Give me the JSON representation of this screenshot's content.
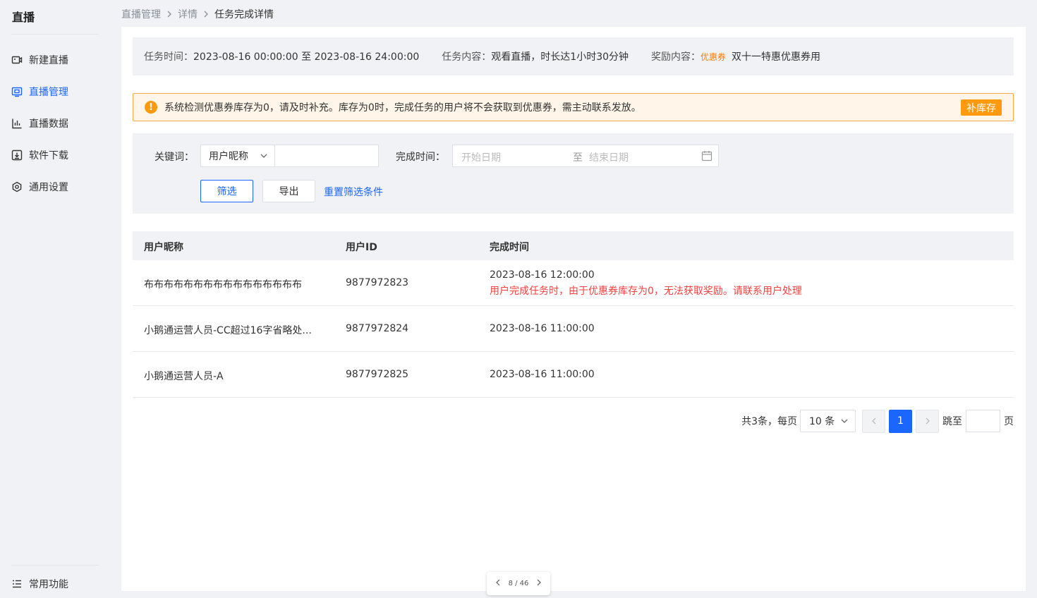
{
  "app": {
    "title": "直播"
  },
  "sidebar": {
    "items": [
      {
        "label": "新建直播",
        "icon": "camera-icon",
        "active": false
      },
      {
        "label": "直播管理",
        "icon": "tv-icon",
        "active": true
      },
      {
        "label": "直播数据",
        "icon": "bar-chart-icon",
        "active": false
      },
      {
        "label": "软件下载",
        "icon": "download-icon",
        "active": false
      },
      {
        "label": "通用设置",
        "icon": "gear-icon",
        "active": false
      }
    ],
    "bottom_item": {
      "label": "常用功能",
      "icon": "list-icon"
    }
  },
  "breadcrumb": {
    "items": [
      "直播管理",
      "详情"
    ],
    "current": "任务完成详情"
  },
  "task_info": {
    "time_label": "任务时间：",
    "time_value": "2023-08-16 00:00:00 至 2023-08-16 24:00:00",
    "content_label": "任务内容：",
    "content_value": "观看直播，时长达1小时30分钟",
    "reward_label": "奖励内容：",
    "reward_tag": "优惠券",
    "reward_value": "双十一特惠优惠券用"
  },
  "alert": {
    "icon": "warning-icon",
    "message": "系统检测优惠券库存为0，请及时补充。库存为0时，完成任务的用户将不会获取到优惠券，需主动联系发放。",
    "button": "补库存"
  },
  "filter": {
    "keyword_label": "关键词：",
    "keyword_select": "用户昵称",
    "keyword_value": "",
    "time_label": "完成时间：",
    "start_placeholder": "开始日期",
    "range_sep": "至",
    "end_placeholder": "结束日期",
    "filter_button": "筛选",
    "export_button": "导出",
    "reset_link": "重置筛选条件"
  },
  "table": {
    "headers": [
      "用户昵称",
      "用户ID",
      "完成时间"
    ],
    "rows": [
      {
        "nickname": "布布布布布布布布布布布布布布布布",
        "user_id": "9877972823",
        "time": "2023-08-16 12:00:00",
        "note": "用户完成任务时，由于优惠券库存为0，无法获取奖励。请联系用户处理"
      },
      {
        "nickname": "小鹅通运营人员-CC超过16字省略处...",
        "user_id": "9877972824",
        "time": "2023-08-16 11:00:00",
        "note": ""
      },
      {
        "nickname": "小鹅通运营人员-A",
        "user_id": "9877972825",
        "time": "2023-08-16 11:00:00",
        "note": ""
      }
    ]
  },
  "pagination": {
    "total_text": "共3条，每页",
    "page_size": "10 条",
    "current_page": "1",
    "jump_label": "跳至",
    "page_suffix": "页"
  },
  "footer": {
    "page_indicator": "8 / 46"
  },
  "colors": {
    "accent": "#1a66ff",
    "warning": "#ff9a0f",
    "error": "#f53f3f",
    "reward_tag": "#ff7d00"
  }
}
